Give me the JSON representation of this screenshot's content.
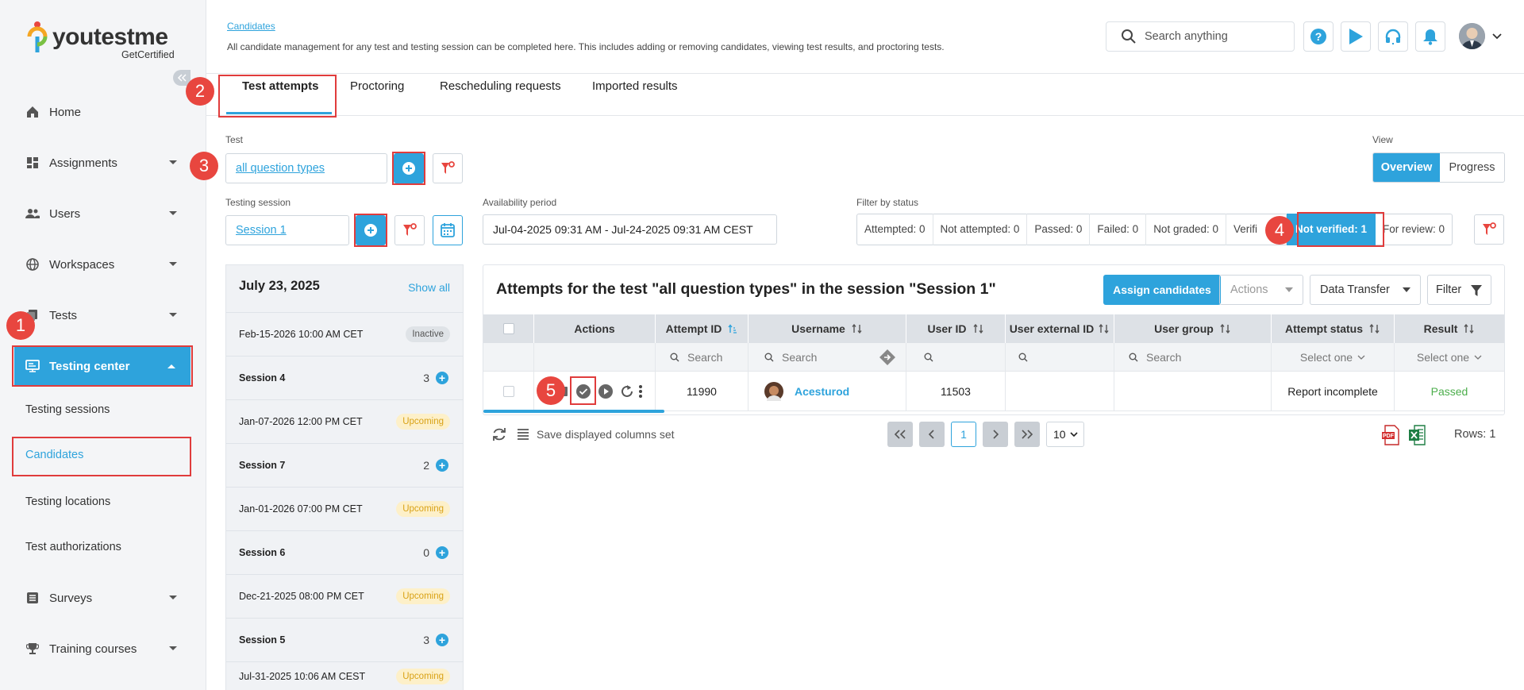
{
  "brand": {
    "name": "youtestme",
    "tagline": "GetCertified",
    "accent": "#2ea3dc",
    "danger": "#e8463f"
  },
  "sidebar": {
    "collapse_icon": "double-chevron-left-icon",
    "items": [
      {
        "label": "Home",
        "icon": "home-icon"
      },
      {
        "label": "Assignments",
        "icon": "dashboard-icon"
      },
      {
        "label": "Users",
        "icon": "users-icon"
      },
      {
        "label": "Workspaces",
        "icon": "globe-icon"
      },
      {
        "label": "Tests",
        "icon": "tests-icon"
      },
      {
        "label": "Testing center",
        "icon": "monitor-icon"
      },
      {
        "label": "Surveys",
        "icon": "list-icon"
      },
      {
        "label": "Training courses",
        "icon": "trophy-icon"
      }
    ],
    "subitems": [
      "Testing sessions",
      "Candidates",
      "Testing locations",
      "Test authorizations"
    ]
  },
  "header": {
    "breadcrumb": "Candidates",
    "description": "All candidate management for any test and testing session can be completed here. This includes adding or removing candidates, viewing test results, and proctoring tests.",
    "search_placeholder": "Search anything"
  },
  "tabs": [
    "Test attempts",
    "Proctoring",
    "Rescheduling requests",
    "Imported results"
  ],
  "filters": {
    "test_label": "Test",
    "test_value": "all question types",
    "session_label": "Testing session",
    "session_value": "Session 1",
    "availability_label": "Availability period",
    "availability_value": "Jul-04-2025 09:31 AM - Jul-24-2025 09:31 AM CEST",
    "status_label": "Filter by status",
    "statuses": [
      "Attempted: 0",
      "Not attempted: 0",
      "Passed: 0",
      "Failed: 0",
      "Not graded: 0",
      "Verifi"
    ],
    "status_active": "Not verified: 1",
    "status_after": "For review: 0",
    "view_label": "View",
    "view_options": [
      "Overview",
      "Progress"
    ]
  },
  "sessions": {
    "date": "July 23, 2025",
    "show_all": "Show all",
    "rows": [
      {
        "text": "Feb-15-2026 10:00 AM CET",
        "pill": "Inactive"
      },
      {
        "text": "Session 4",
        "count": "3"
      },
      {
        "text": "Jan-07-2026 12:00 PM CET",
        "pill": "Upcoming"
      },
      {
        "text": "Session 7",
        "count": "2"
      },
      {
        "text": "Jan-01-2026 07:00 PM CET",
        "pill": "Upcoming"
      },
      {
        "text": "Session 6",
        "count": "0"
      },
      {
        "text": "Dec-21-2025 08:00 PM CET",
        "pill": "Upcoming"
      },
      {
        "text": "Session 5",
        "count": "3"
      },
      {
        "text": "Jul-31-2025 10:06 AM CEST",
        "pill": "Upcoming"
      }
    ]
  },
  "table": {
    "title": "Attempts for the test \"all question types\" in the session \"Session 1\"",
    "assign_button": "Assign candidates",
    "actions_button": "Actions",
    "transfer_button": "Data Transfer",
    "filter_button": "Filter",
    "columns": [
      "Actions",
      "Attempt ID",
      "Username",
      "User ID",
      "User external ID",
      "User group",
      "Attempt status",
      "Result"
    ],
    "search_placeholder": "Search",
    "select_placeholder": "Select one",
    "row": {
      "attempt_id": "11990",
      "username": "Acesturod",
      "user_id": "11503",
      "status": "Report incomplete",
      "result": "Passed"
    },
    "footer": {
      "save_columns": "Save displayed columns set",
      "page": "1",
      "page_size": "10",
      "rows": "Rows: 1"
    }
  },
  "annotations": [
    "1",
    "2",
    "3",
    "4",
    "5"
  ]
}
